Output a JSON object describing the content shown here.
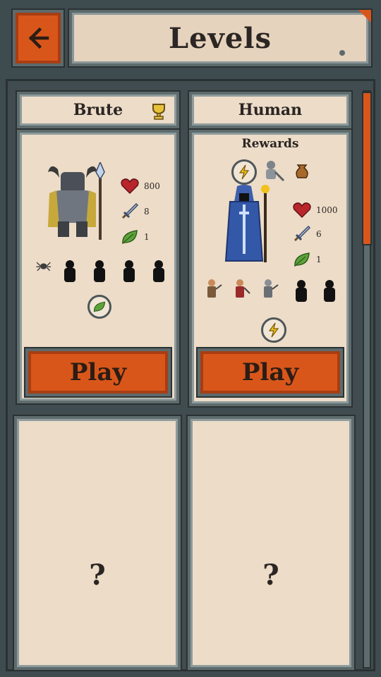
{
  "header": {
    "title": "Levels",
    "back_icon": "arrow-left-icon"
  },
  "levels": [
    {
      "name": "Brute",
      "badge_icon": "trophy-icon",
      "stats": {
        "health": "800",
        "attack": "8",
        "speed": "1"
      },
      "enemies_icon": "spider-icon",
      "reward_icon": "leaf-icon",
      "play_label": "Play"
    },
    {
      "name": "Human",
      "rewards_label": "Rewards",
      "stats": {
        "health": "1000",
        "attack": "6",
        "speed": "1"
      },
      "reward_top_icon": "lightning-icon",
      "reward_bottom_icon": "lightning-icon",
      "play_label": "Play"
    },
    {
      "name": "",
      "mystery": "?"
    },
    {
      "name": "",
      "mystery": "?"
    }
  ],
  "colors": {
    "accent": "#d9561b",
    "panel": "#ecdcc8",
    "frame": "#5f6c6e"
  }
}
